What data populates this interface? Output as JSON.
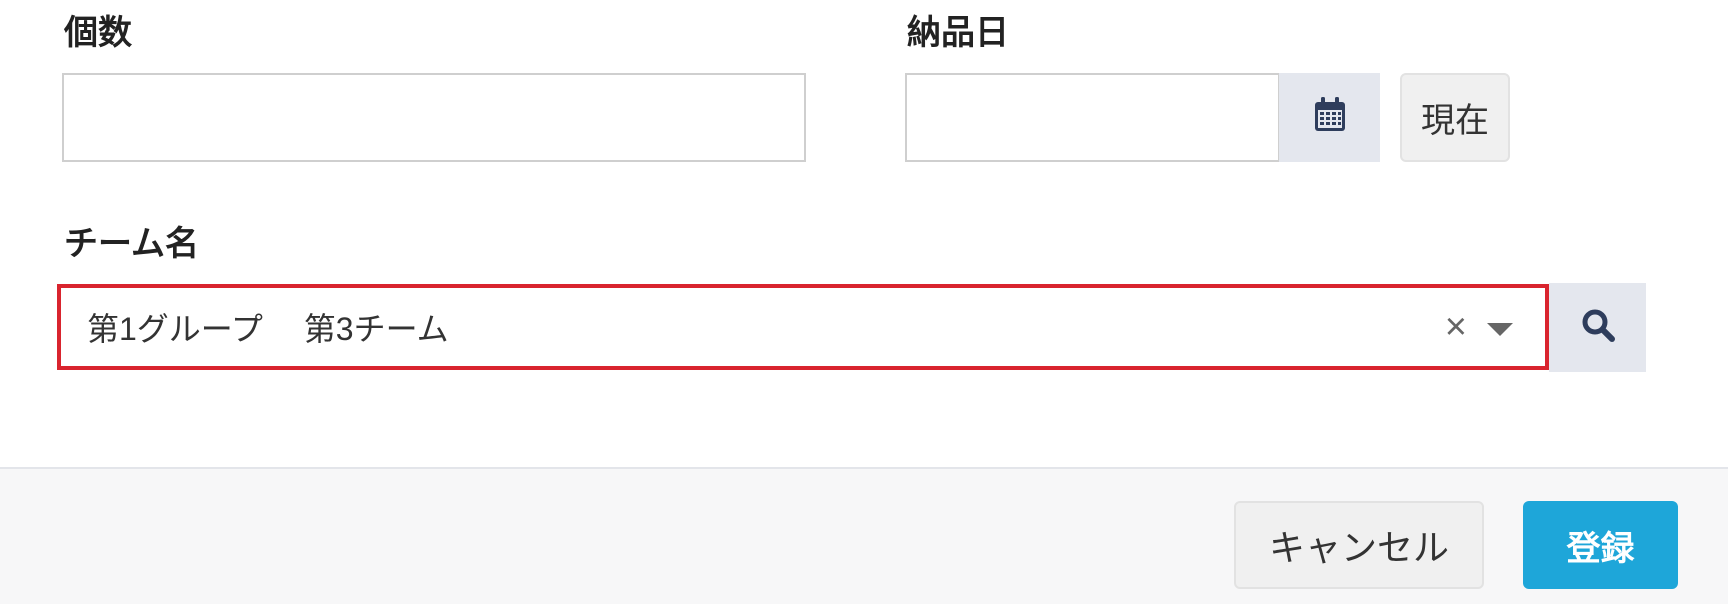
{
  "form": {
    "quantity_label": "個数",
    "quantity_value": "",
    "delivery_date_label": "納品日",
    "delivery_date_value": "",
    "now_button_label": "現在",
    "team_name_label": "チーム名",
    "team_name_value": "第1グループ　 第3チーム",
    "clear_symbol": "×"
  },
  "footer": {
    "cancel_label": "キャンセル",
    "submit_label": "登録"
  },
  "icons": {
    "calendar": "calendar-icon",
    "search": "search-icon",
    "clear": "clear-icon",
    "dropdown": "chevron-down-icon"
  },
  "colors": {
    "accent": "#1ea6d9",
    "highlight_border": "#d9242e",
    "addon_bg": "#e4e7ee",
    "icon_navy": "#2e3d5c"
  }
}
